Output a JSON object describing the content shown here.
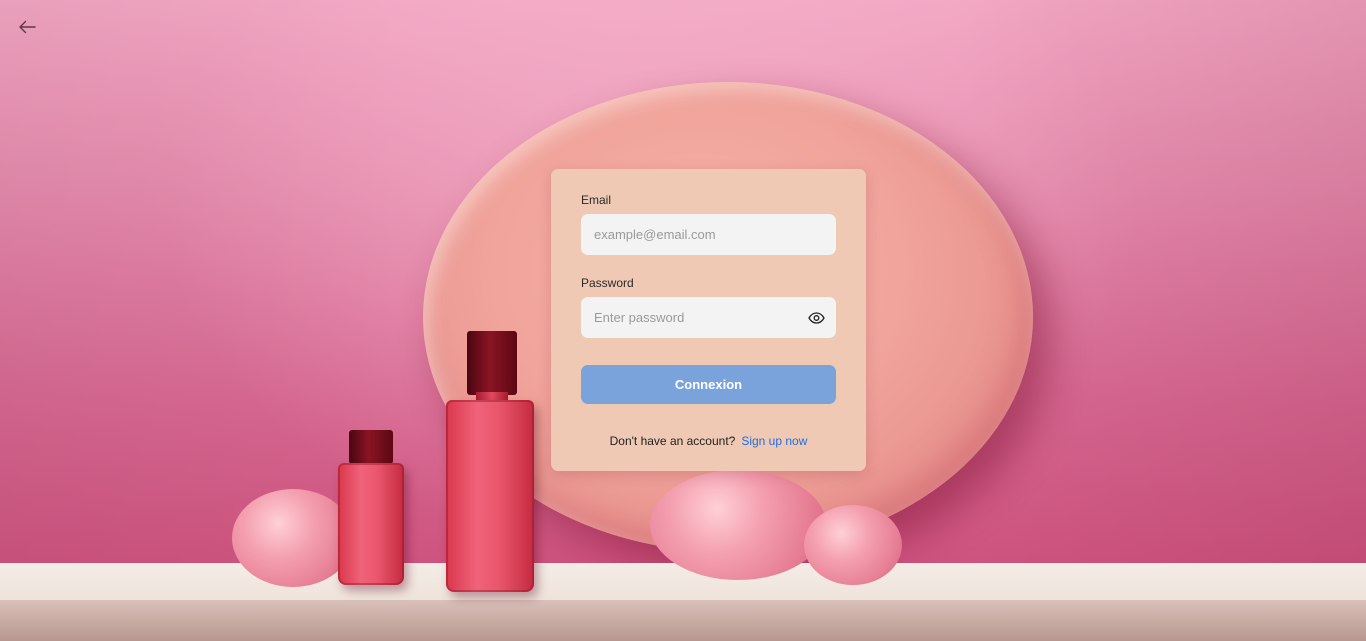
{
  "form": {
    "email_label": "Email",
    "email_placeholder": "example@email.com",
    "email_value": "",
    "password_label": "Password",
    "password_placeholder": "Enter password",
    "password_value": "",
    "submit_label": "Connexion",
    "signup_prompt": "Don't have an account?",
    "signup_link": "Sign up now"
  },
  "icons": {
    "back": "arrow-left-icon",
    "password_toggle": "eye-icon"
  },
  "colors": {
    "card_background": "#efc9b3",
    "submit_background": "#7aa3dc",
    "link": "#1f6fe0"
  }
}
